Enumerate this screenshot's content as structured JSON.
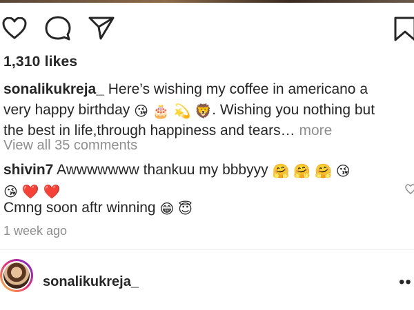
{
  "post": {
    "likes": "1,310 likes",
    "caption": {
      "username": "sonalikukreja_",
      "line1": "Here’s wishing my coffee in americano a",
      "line2": "very happy birthday",
      "line2_emojis": [
        "😘",
        "🎂",
        "💫",
        "🦁"
      ],
      "line2_after": ". Wishing you nothing but",
      "line3": "the best in life,through happiness and tears…",
      "more": "more"
    },
    "view_all_comments": "View all 35 comments",
    "comments": [
      {
        "username": "shivin7",
        "text": "Awwwwwww thankuu my bbbyyy",
        "emojis_line1": [
          "🤗",
          "🤗",
          "🤗",
          "😘"
        ],
        "emojis_line2": [
          "😘",
          "❤️",
          "❤️"
        ]
      },
      {
        "username": "",
        "text": "Cmng soon aftr winning",
        "emojis": [
          "😁",
          "😇"
        ]
      }
    ],
    "timestamp": "1 week ago"
  },
  "footer": {
    "username": "sonalikukreja_",
    "menu_glyph": "••"
  },
  "icons": {
    "like": "heart-icon",
    "comment": "comment-icon",
    "share": "paper-plane-icon",
    "save": "bookmark-icon"
  },
  "colors": {
    "text": "#262626",
    "muted": "#8e8e8e",
    "heart": "#e0245e"
  }
}
